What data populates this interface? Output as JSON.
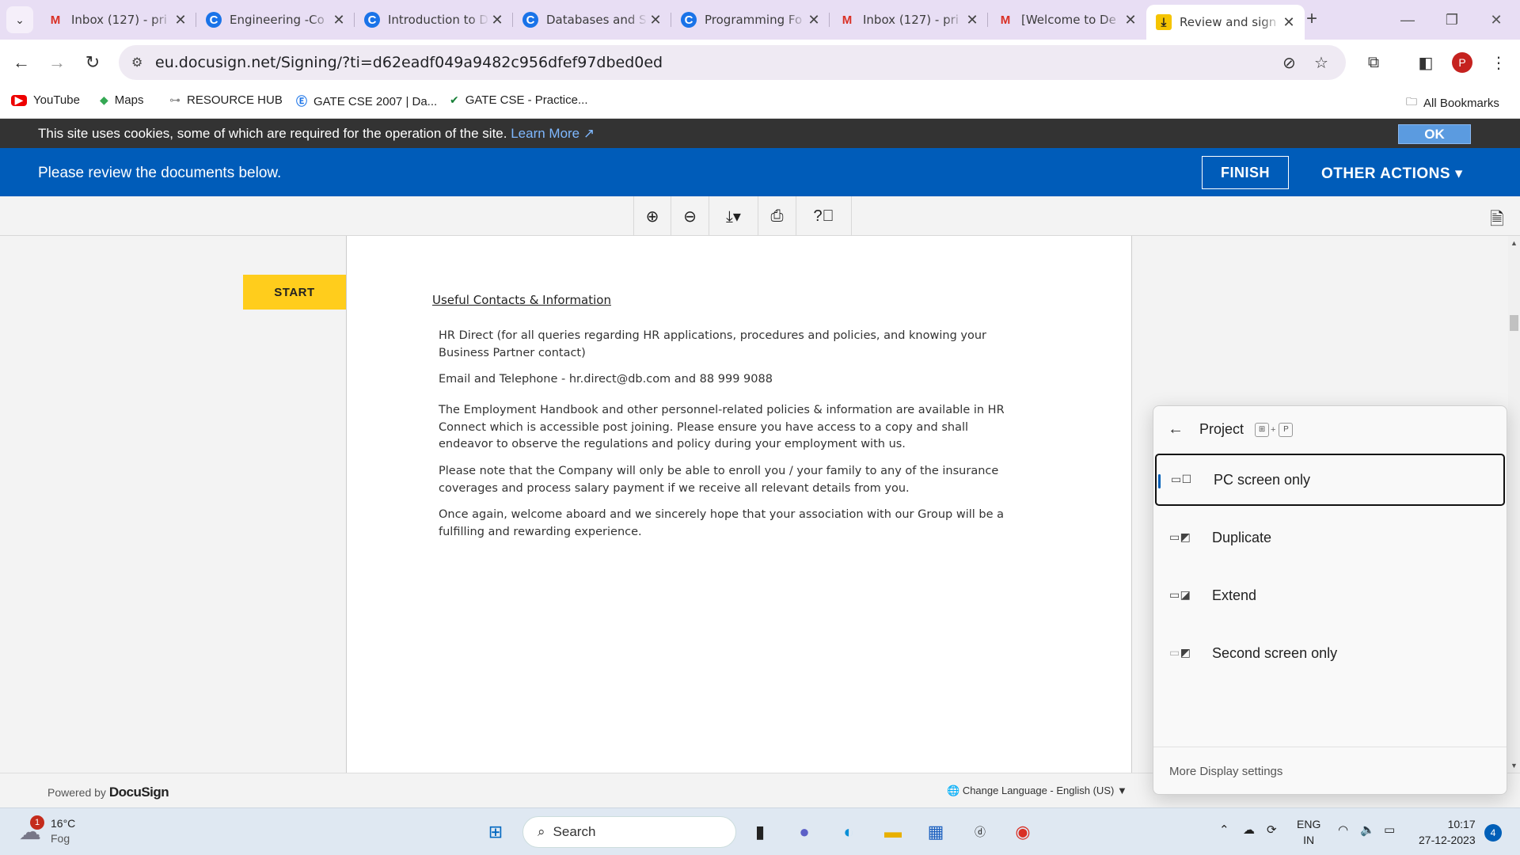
{
  "browser": {
    "tabs": [
      {
        "title": "Inbox (127) - pri",
        "icon": "gmail-icon"
      },
      {
        "title": "Engineering -Co",
        "icon": "chrome-g-icon"
      },
      {
        "title": "Introduction to D",
        "icon": "chrome-g-icon"
      },
      {
        "title": "Databases and S",
        "icon": "chrome-g-icon"
      },
      {
        "title": "Programming Fo",
        "icon": "chrome-g-icon"
      },
      {
        "title": "Inbox (127) - pri",
        "icon": "gmail-icon"
      },
      {
        "title": "[Welcome to De",
        "icon": "gmail-icon"
      },
      {
        "title": "Review and sign",
        "icon": "docusign-icon",
        "active": true
      }
    ],
    "url": "eu.docusign.net/Signing/?ti=d62eadf049a9482c956dfef97dbed0ed",
    "profile_initial": "P",
    "bookmarks": [
      "YouTube",
      "Maps",
      "RESOURCE HUB",
      "GATE CSE 2007 | Da...",
      "GATE CSE - Practice..."
    ],
    "all_bookmarks": "All Bookmarks"
  },
  "cookie_bar": {
    "text": "This site uses cookies, some of which are required for the operation of the site.",
    "link": "Learn More",
    "ok": "OK"
  },
  "docusign": {
    "header_message": "Please review the documents below.",
    "finish": "FINISH",
    "other_actions": "OTHER ACTIONS ▾",
    "start": "START",
    "powered_by": "Powered by",
    "brand": "DocuSign",
    "language": "Change Language - English (US)"
  },
  "document": {
    "heading": "Useful Contacts & Information",
    "paragraphs": [
      "HR Direct (for all queries regarding HR applications, procedures and policies, and knowing your Business Partner contact)",
      "Email and Telephone - hr.direct@db.com and 88 999 9088",
      "The Employment Handbook and other personnel-related policies & information are available in HR Connect which is accessible post joining. Please ensure you have access to a copy and shall endeavor to observe the regulations and policy during your employment with us.",
      "Please note that the Company will only be able to enroll you / your family to any of the insurance coverages and process salary payment if we receive all relevant details from you.",
      "Once again, welcome aboard and we sincerely hope that your association with our Group will be a fulfilling and rewarding experience."
    ]
  },
  "project_flyout": {
    "title": "Project",
    "shortcut_key": "P",
    "options": [
      {
        "label": "PC screen only",
        "selected": true
      },
      {
        "label": "Duplicate",
        "selected": false
      },
      {
        "label": "Extend",
        "selected": false
      },
      {
        "label": "Second screen only",
        "selected": false
      }
    ],
    "more_settings": "More Display settings"
  },
  "taskbar": {
    "weather_badge": "1",
    "temperature": "16°C",
    "condition": "Fog",
    "search_placeholder": "Search",
    "lang_top": "ENG",
    "lang_bottom": "IN",
    "time": "10:17",
    "date": "27-12-2023",
    "notification_count": "4"
  },
  "colors": {
    "docusign_blue": "#005cb9",
    "start_yellow": "#ffcd1c",
    "tab_strip": "#e8def4"
  }
}
